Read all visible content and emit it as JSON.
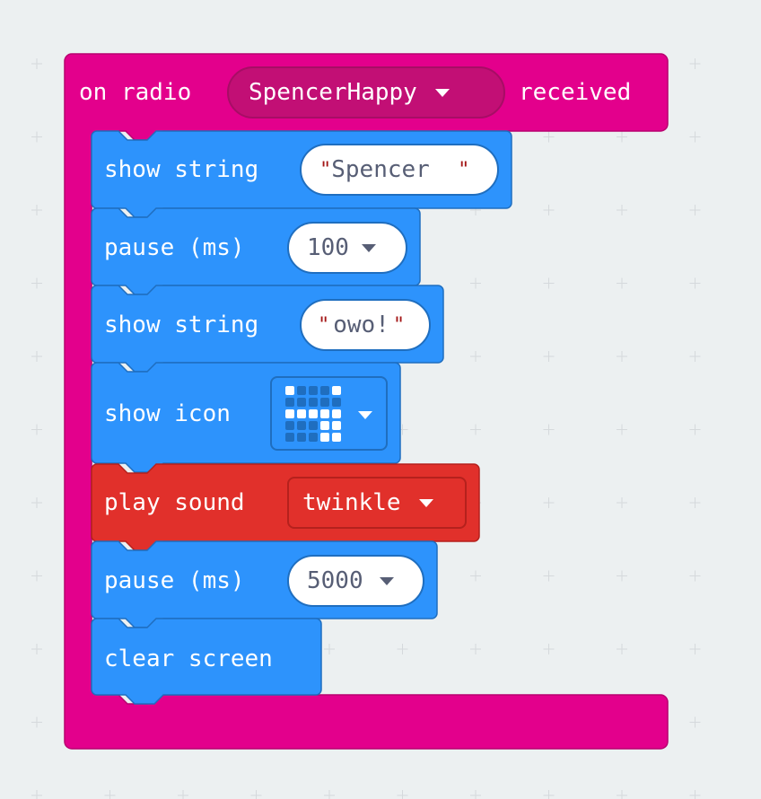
{
  "colors": {
    "background": "#ecf0f1",
    "radio_block": "#e3008c",
    "radio_block_dark": "#c20f75",
    "basic_block": "#2d93fc",
    "basic_block_border": "#1f6ebf",
    "music_block": "#e1302b",
    "music_block_border": "#b5211d",
    "string_quote": "#a31515",
    "field_text": "#575e75"
  },
  "event_block": {
    "prefix": "on radio",
    "dropdown_value": "SpencerHappy",
    "suffix": "received"
  },
  "statements": [
    {
      "type": "show_string",
      "label": "show string",
      "value": "Spencer  ",
      "quote_open": "\"",
      "quote_close": "\""
    },
    {
      "type": "pause",
      "label": "pause (ms)",
      "value": "100"
    },
    {
      "type": "show_string",
      "label": "show string",
      "value": "owo!",
      "quote_open": "\"",
      "quote_close": "\""
    },
    {
      "type": "show_icon",
      "label": "show icon",
      "icon_name": "led-pattern-icon",
      "led_matrix": [
        [
          1,
          0,
          0,
          0,
          1
        ],
        [
          0,
          0,
          0,
          0,
          0
        ],
        [
          1,
          1,
          1,
          1,
          1
        ],
        [
          0,
          0,
          0,
          1,
          1
        ],
        [
          0,
          0,
          0,
          1,
          1
        ]
      ]
    },
    {
      "type": "play_sound",
      "label": "play sound",
      "value": "twinkle"
    },
    {
      "type": "pause",
      "label": "pause (ms)",
      "value": "5000"
    },
    {
      "type": "clear_screen",
      "label": "clear screen"
    }
  ]
}
